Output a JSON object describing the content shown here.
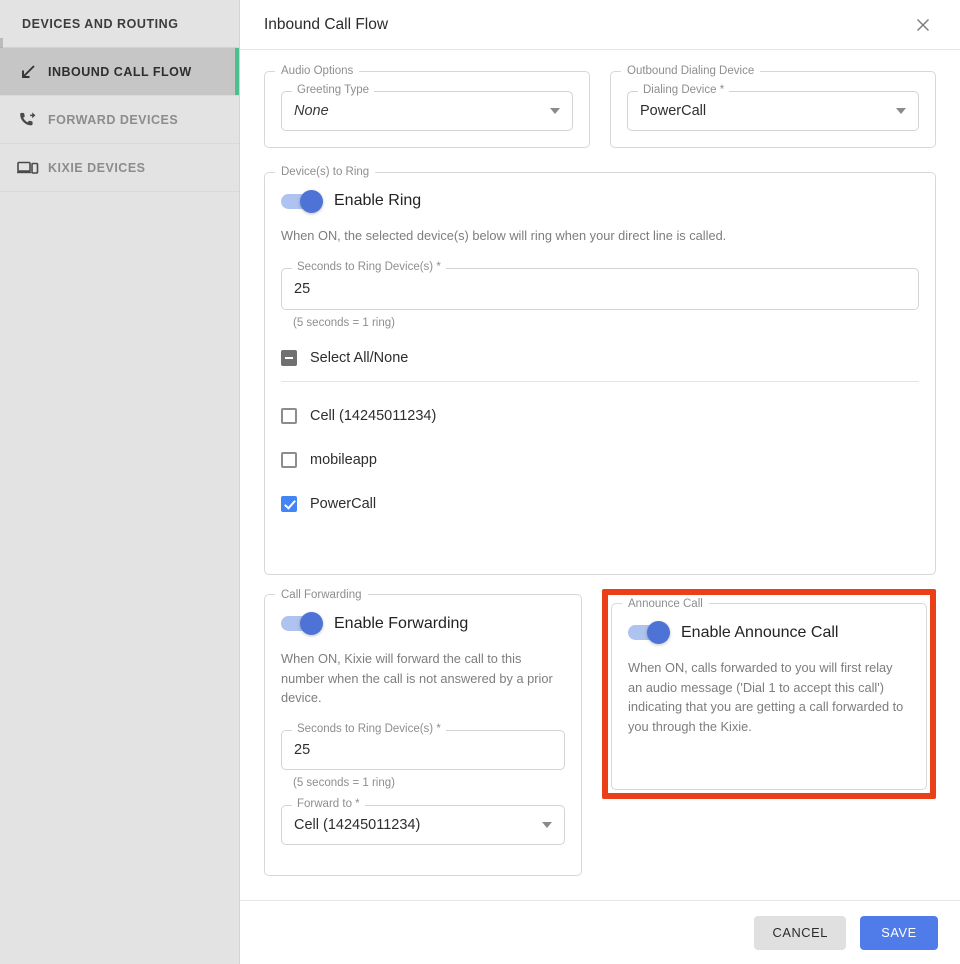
{
  "sidebar": {
    "header": "DEVICES AND ROUTING",
    "items": [
      {
        "label": "INBOUND CALL FLOW",
        "icon": "inbound-arrow-icon",
        "active": true
      },
      {
        "label": "FORWARD DEVICES",
        "icon": "phone-forward-icon",
        "active": false
      },
      {
        "label": "KIXIE DEVICES",
        "icon": "devices-icon",
        "active": false
      }
    ]
  },
  "panel": {
    "title": "Inbound Call Flow",
    "close_icon": "close-icon"
  },
  "audio_options": {
    "legend": "Audio Options",
    "greeting_type": {
      "label": "Greeting Type",
      "value": "None"
    }
  },
  "outbound_dialing_device": {
    "legend": "Outbound Dialing Device",
    "dialing_device": {
      "label": "Dialing Device *",
      "value": "PowerCall"
    }
  },
  "devices_to_ring": {
    "legend": "Device(s) to Ring",
    "toggle_label": "Enable Ring",
    "toggle_on": true,
    "description": "When ON, the selected device(s) below will ring when your direct line is called.",
    "seconds_field": {
      "label": "Seconds to Ring Device(s) *",
      "value": "25"
    },
    "seconds_hint": "(5 seconds = 1 ring)",
    "select_all_label": "Select All/None",
    "select_all_state": "indeterminate",
    "devices": [
      {
        "label": "Cell (14245011234)",
        "checked": false
      },
      {
        "label": "mobileapp",
        "checked": false
      },
      {
        "label": "PowerCall",
        "checked": true
      }
    ]
  },
  "call_forwarding": {
    "legend": "Call Forwarding",
    "toggle_label": "Enable Forwarding",
    "toggle_on": true,
    "description": "When ON, Kixie will forward the call to this number when the call is not answered by a prior device.",
    "seconds_field": {
      "label": "Seconds to Ring Device(s) *",
      "value": "25"
    },
    "seconds_hint": "(5 seconds = 1 ring)",
    "forward_to": {
      "label": "Forward to *",
      "value": "Cell (14245011234)"
    }
  },
  "announce_call": {
    "legend": "Announce Call",
    "toggle_label": "Enable Announce Call",
    "toggle_on": true,
    "description": "When ON, calls forwarded to you will first relay an audio message ('Dial 1 to accept this call') indicating that you are getting a call forwarded to you through the Kixie.",
    "highlighted": true
  },
  "footer": {
    "cancel_label": "CANCEL",
    "save_label": "SAVE"
  },
  "colors": {
    "accent_green": "#4cc08c",
    "toggle_blue": "#4d73d6",
    "toggle_track": "#aec3ef",
    "checkbox_blue": "#4285f4",
    "save_blue": "#4f7ce8",
    "highlight_red": "#ea3f17"
  }
}
